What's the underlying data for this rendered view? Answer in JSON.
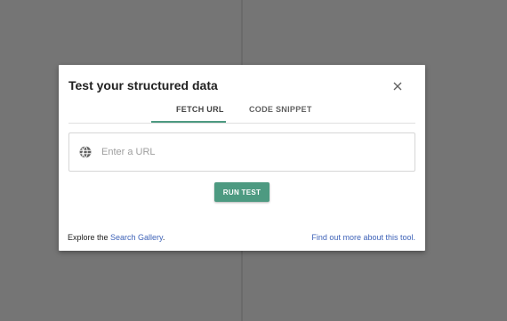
{
  "dialog": {
    "title": "Test your structured data",
    "close_icon": "close-icon",
    "tabs": [
      {
        "label": "FETCH URL",
        "active": true
      },
      {
        "label": "CODE SNIPPET",
        "active": false
      }
    ],
    "url_input": {
      "placeholder": "Enter a URL",
      "value": "",
      "icon": "globe-icon"
    },
    "run_button_label": "RUN TEST",
    "footer": {
      "explore_prefix": "Explore the ",
      "gallery_link": "Search Gallery",
      "explore_suffix": ".",
      "find_out_link": "Find out more about this tool."
    }
  },
  "colors": {
    "accent": "#4d9a81",
    "link": "#3f63b8",
    "backdrop": "#757575"
  }
}
